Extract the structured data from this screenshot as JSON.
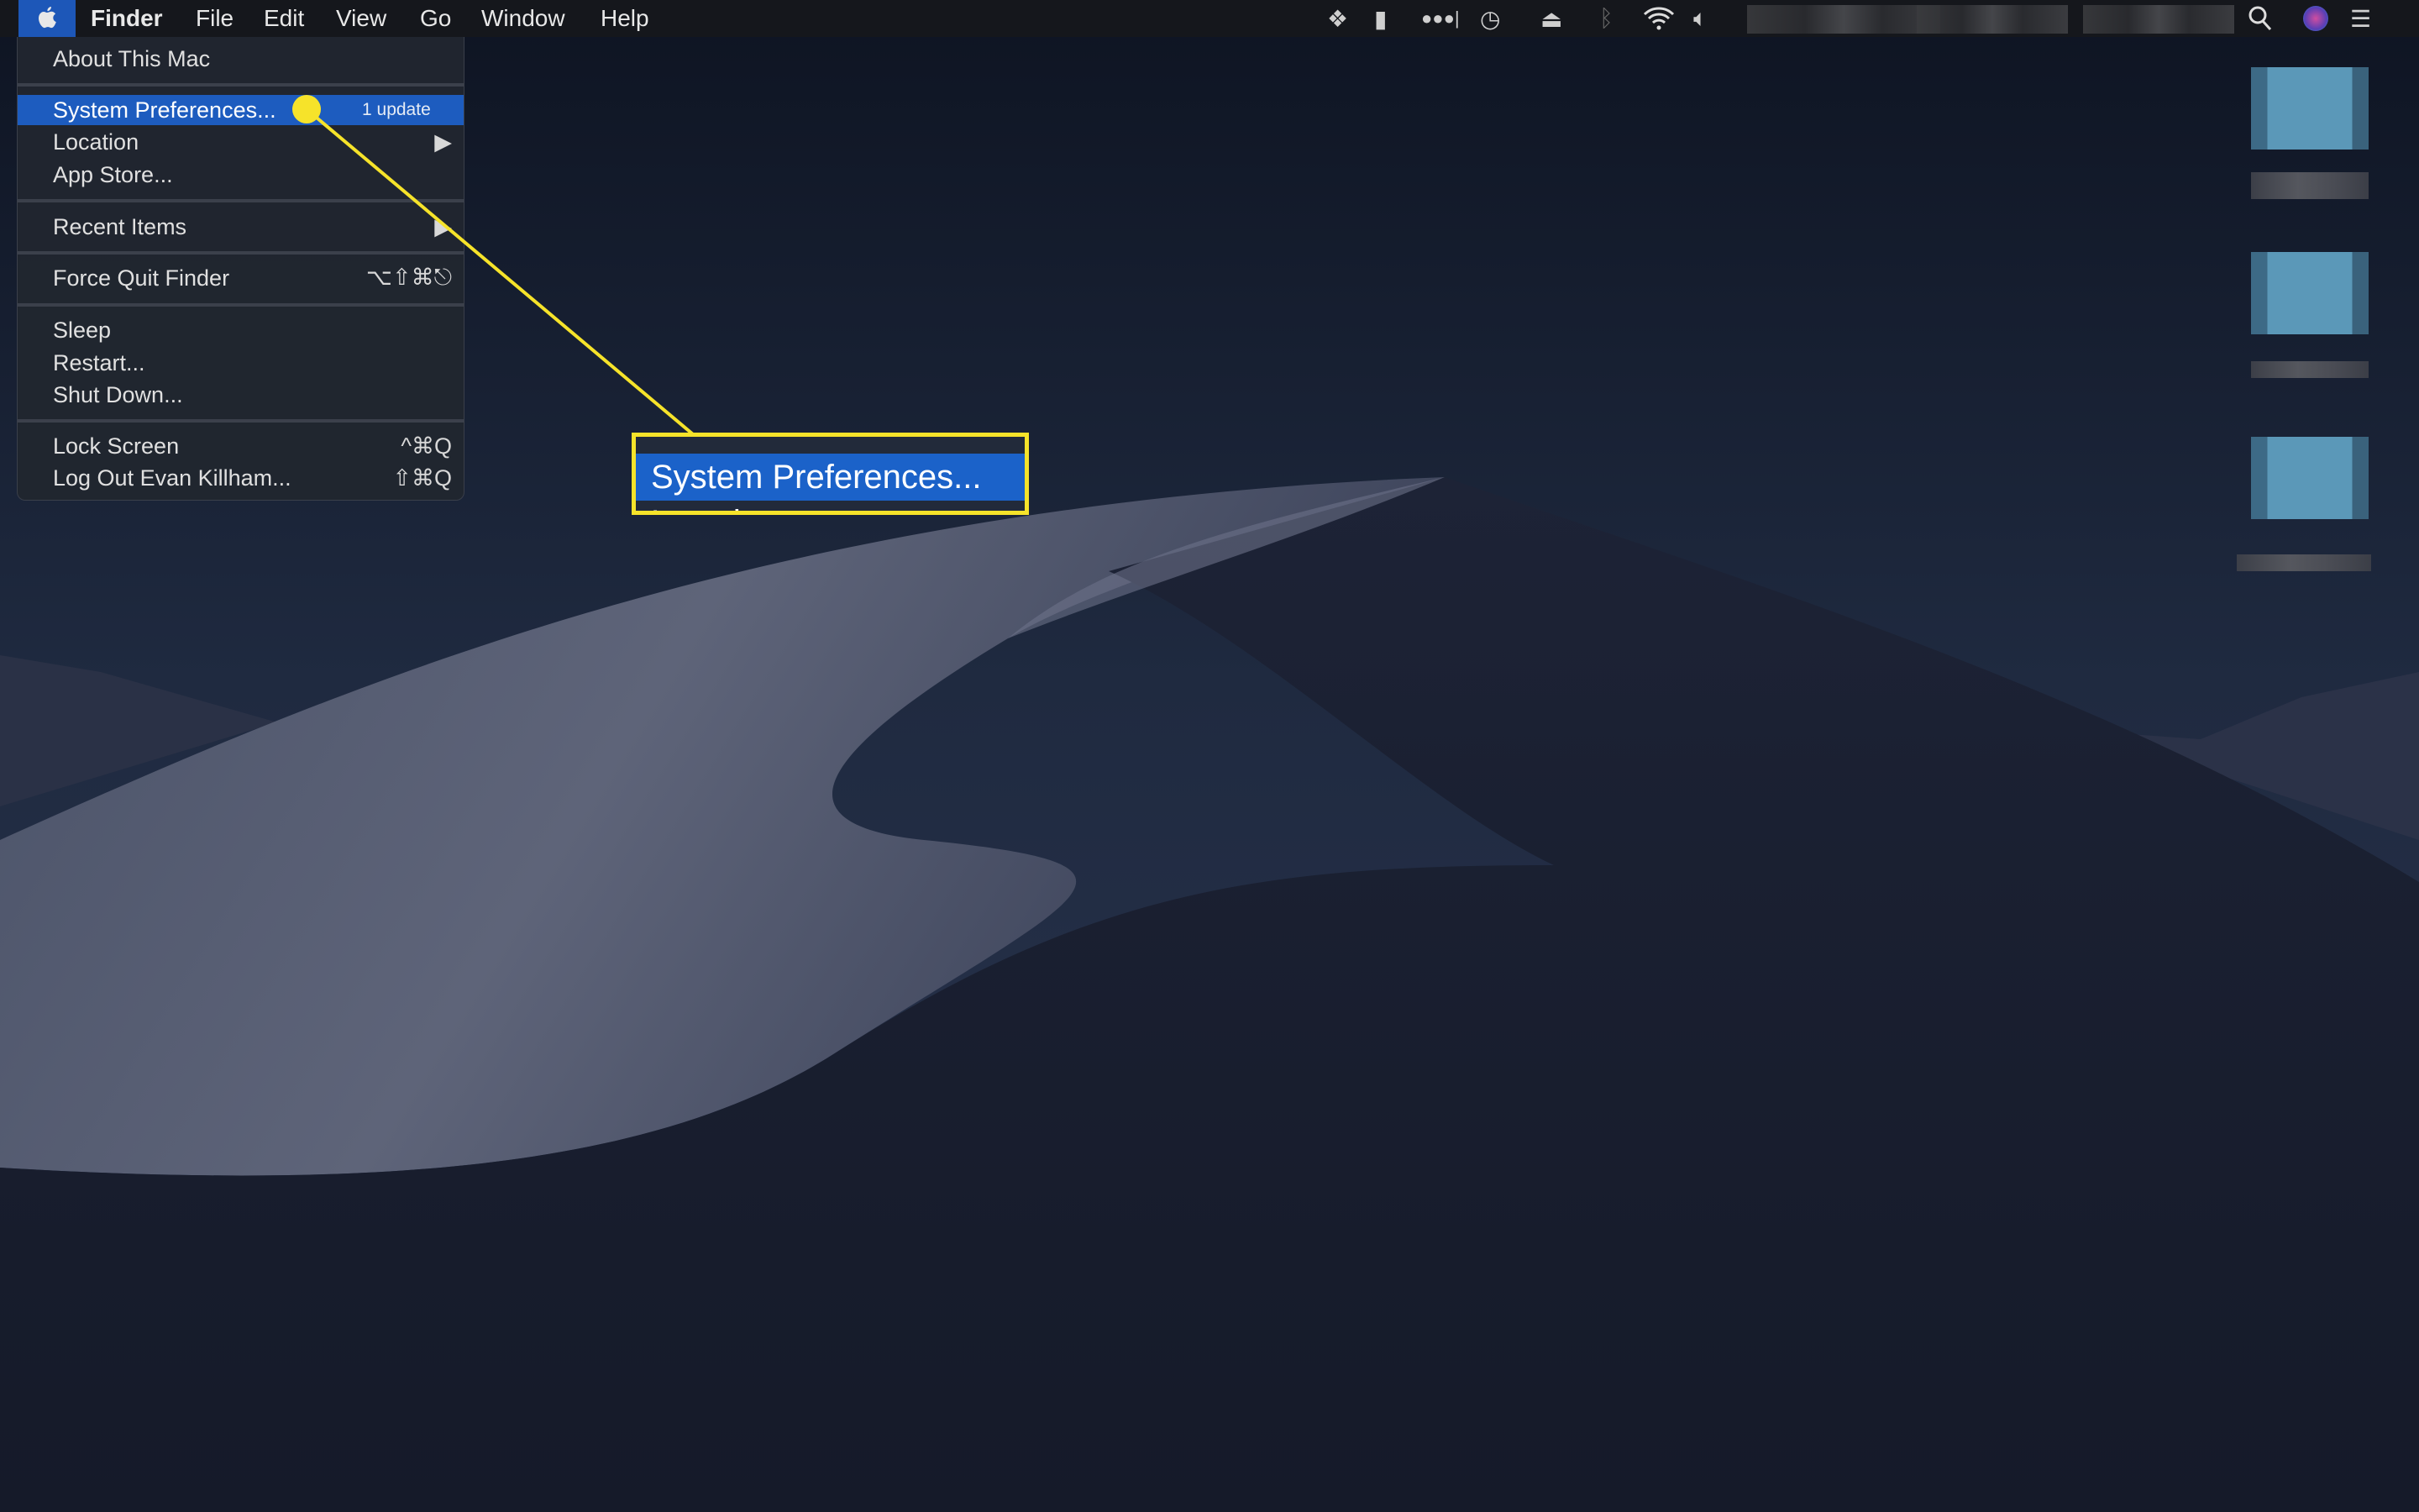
{
  "menubar": {
    "app_name": "Finder",
    "menus": [
      "File",
      "Edit",
      "View",
      "Go",
      "Window",
      "Help"
    ],
    "status_icons": [
      "dropbox-icon",
      "notification-icon",
      "more-icon",
      "time-machine-icon",
      "airplay-icon",
      "bluetooth-icon",
      "wifi-icon",
      "volume-icon",
      "spotlight-search-icon",
      "siri-icon",
      "notification-center-icon"
    ]
  },
  "apple_menu": {
    "items": [
      {
        "label": "About This Mac"
      },
      {
        "label": "System Preferences...",
        "badge": "1 update",
        "highlighted": true
      },
      {
        "label": "Location",
        "submenu": true
      },
      {
        "label": "App Store..."
      },
      {
        "label": "Recent Items",
        "submenu": true
      },
      {
        "label": "Force Quit Finder",
        "shortcut": "⌥⇧⌘⎋"
      },
      {
        "label": "Sleep"
      },
      {
        "label": "Restart..."
      },
      {
        "label": "Shut Down..."
      },
      {
        "label": "Lock Screen",
        "shortcut": "^⌘Q"
      },
      {
        "label": "Log Out Evan Killham...",
        "shortcut": "⇧⌘Q"
      }
    ]
  },
  "callout": {
    "label": "System Preferences...",
    "peek": "Location",
    "color": "#f6e32a"
  },
  "colors": {
    "highlight": "#1d5cbf",
    "annotation": "#f6e32a"
  }
}
